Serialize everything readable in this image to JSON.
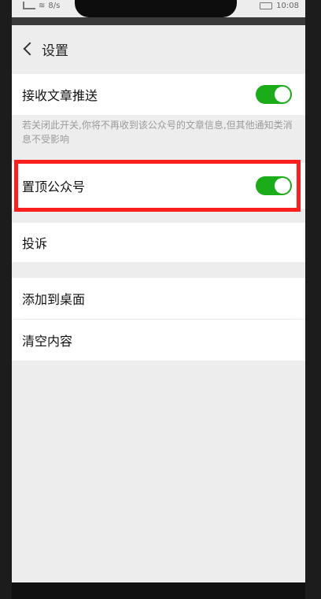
{
  "status": {
    "left_text": "8/s",
    "time": "10:08"
  },
  "nav": {
    "title": "设置"
  },
  "settings": {
    "receive_push": {
      "label": "接收文章推送",
      "enabled": true
    },
    "hint": "若关闭此开关,你将不再收到该公众号的文章信息,但其他通知类消息不受影响",
    "pin_top": {
      "label": "置顶公众号",
      "enabled": true
    },
    "complain": {
      "label": "投诉"
    },
    "add_desktop": {
      "label": "添加到桌面"
    },
    "clear_content": {
      "label": "清空内容"
    }
  },
  "colors": {
    "toggle_on": "#1aad19",
    "highlight": "#ff1e1e"
  }
}
